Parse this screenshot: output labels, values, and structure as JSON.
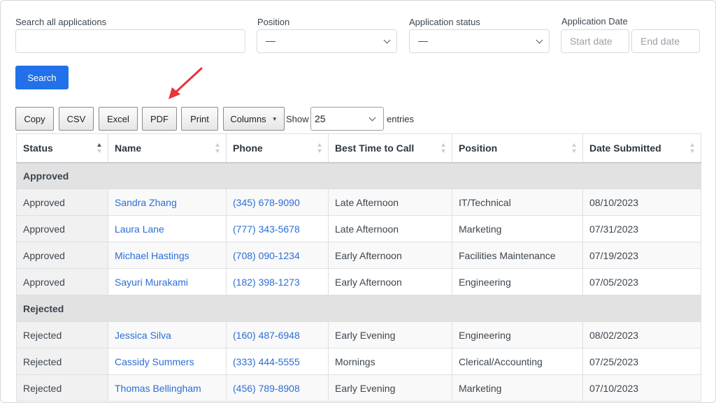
{
  "filters": {
    "search_label": "Search all applications",
    "search_value": "",
    "position_label": "Position",
    "position_value": "—",
    "status_label": "Application status",
    "status_value": "—",
    "date_label": "Application Date",
    "start_placeholder": "Start date",
    "end_placeholder": "End date",
    "search_button": "Search"
  },
  "toolbar": {
    "copy": "Copy",
    "csv": "CSV",
    "excel": "Excel",
    "pdf": "PDF",
    "print": "Print",
    "columns": "Columns",
    "show": "Show",
    "entries_value": "25",
    "entries": "entries"
  },
  "colors": {
    "accent": "#2271ea",
    "link": "#2a6ed8",
    "arrow": "#e8323c",
    "group_row": "#e2e2e2"
  },
  "table": {
    "headers": [
      "Status",
      "Name",
      "Phone",
      "Best Time to Call",
      "Position",
      "Date Submitted"
    ],
    "groups": [
      {
        "label": "Approved",
        "rows": [
          {
            "status": "Approved",
            "name": "Sandra Zhang",
            "phone": "(345) 678-9090",
            "best_time": "Late Afternoon",
            "position": "IT/Technical",
            "date": "08/10/2023"
          },
          {
            "status": "Approved",
            "name": "Laura Lane",
            "phone": "(777) 343-5678",
            "best_time": "Late Afternoon",
            "position": "Marketing",
            "date": "07/31/2023"
          },
          {
            "status": "Approved",
            "name": "Michael Hastings",
            "phone": "(708) 090-1234",
            "best_time": "Early Afternoon",
            "position": "Facilities Maintenance",
            "date": "07/19/2023"
          },
          {
            "status": "Approved",
            "name": "Sayuri Murakami",
            "phone": "(182) 398-1273",
            "best_time": "Early Afternoon",
            "position": "Engineering",
            "date": "07/05/2023"
          }
        ]
      },
      {
        "label": "Rejected",
        "rows": [
          {
            "status": "Rejected",
            "name": "Jessica Silva",
            "phone": "(160) 487-6948",
            "best_time": "Early Evening",
            "position": "Engineering",
            "date": "08/02/2023"
          },
          {
            "status": "Rejected",
            "name": "Cassidy Summers",
            "phone": "(333) 444-5555",
            "best_time": "Mornings",
            "position": "Clerical/Accounting",
            "date": "07/25/2023"
          },
          {
            "status": "Rejected",
            "name": "Thomas Bellingham",
            "phone": "(456) 789-8908",
            "best_time": "Early Evening",
            "position": "Marketing",
            "date": "07/10/2023"
          }
        ]
      }
    ]
  }
}
